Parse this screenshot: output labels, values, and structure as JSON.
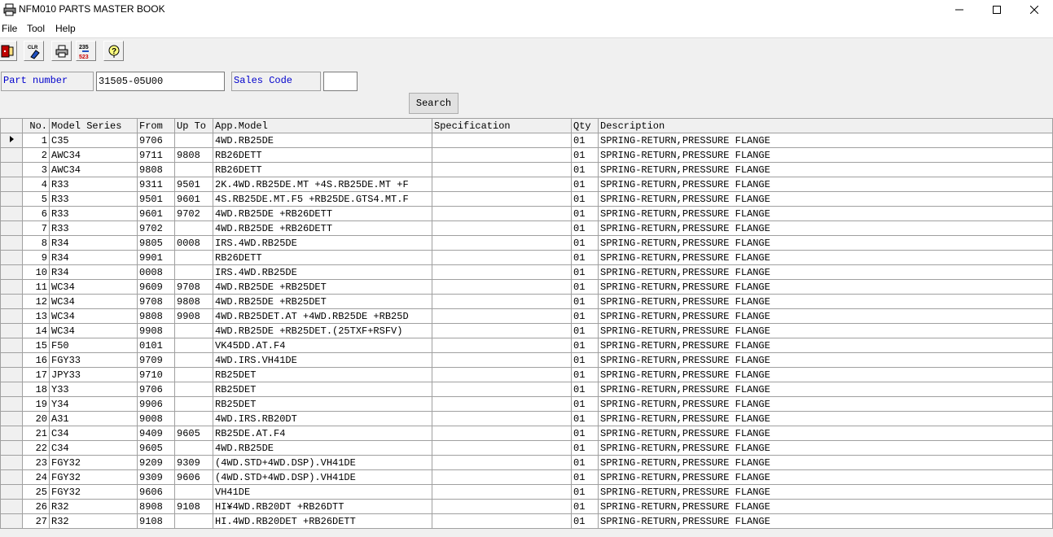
{
  "window": {
    "title": "NFM010 PARTS MASTER BOOK"
  },
  "menu": [
    {
      "label": "File"
    },
    {
      "label": "Tool"
    },
    {
      "label": "Help"
    }
  ],
  "toolbar": {
    "clr_label": "CLR",
    "calc_label_top": "235",
    "calc_label_bottom": "523"
  },
  "form": {
    "part_number_label": "Part number",
    "part_number_value": "31505-05U00",
    "sales_code_label": "Sales Code",
    "sales_code_value": "",
    "search_label": "Search"
  },
  "table": {
    "columns": [
      "No.",
      "Model Series",
      "From",
      "Up To",
      "App.Model",
      "Specification",
      "Qty",
      "Description"
    ],
    "rows": [
      [
        "1",
        "C35",
        "9706",
        "",
        "4WD.RB25DE",
        "",
        "01",
        "SPRING-RETURN,PRESSURE FLANGE"
      ],
      [
        "2",
        "AWC34",
        "9711",
        "9808",
        "RB26DETT",
        "",
        "01",
        "SPRING-RETURN,PRESSURE FLANGE"
      ],
      [
        "3",
        "AWC34",
        "9808",
        "",
        "RB26DETT",
        "",
        "01",
        "SPRING-RETURN,PRESSURE FLANGE"
      ],
      [
        "4",
        "R33",
        "9311",
        "9501",
        "2K.4WD.RB25DE.MT +4S.RB25DE.MT +F",
        "",
        "01",
        "SPRING-RETURN,PRESSURE FLANGE"
      ],
      [
        "5",
        "R33",
        "9501",
        "9601",
        "4S.RB25DE.MT.F5 +RB25DE.GTS4.MT.F",
        "",
        "01",
        "SPRING-RETURN,PRESSURE FLANGE"
      ],
      [
        "6",
        "R33",
        "9601",
        "9702",
        "4WD.RB25DE +RB26DETT",
        "",
        "01",
        "SPRING-RETURN,PRESSURE FLANGE"
      ],
      [
        "7",
        "R33",
        "9702",
        "",
        "4WD.RB25DE +RB26DETT",
        "",
        "01",
        "SPRING-RETURN,PRESSURE FLANGE"
      ],
      [
        "8",
        "R34",
        "9805",
        "0008",
        "IRS.4WD.RB25DE",
        "",
        "01",
        "SPRING-RETURN,PRESSURE FLANGE"
      ],
      [
        "9",
        "R34",
        "9901",
        "",
        "RB26DETT",
        "",
        "01",
        "SPRING-RETURN,PRESSURE FLANGE"
      ],
      [
        "10",
        "R34",
        "0008",
        "",
        "IRS.4WD.RB25DE",
        "",
        "01",
        "SPRING-RETURN,PRESSURE FLANGE"
      ],
      [
        "11",
        "WC34",
        "9609",
        "9708",
        "4WD.RB25DE +RB25DET",
        "",
        "01",
        "SPRING-RETURN,PRESSURE FLANGE"
      ],
      [
        "12",
        "WC34",
        "9708",
        "9808",
        "4WD.RB25DE +RB25DET",
        "",
        "01",
        "SPRING-RETURN,PRESSURE FLANGE"
      ],
      [
        "13",
        "WC34",
        "9808",
        "9908",
        "4WD.RB25DET.AT +4WD.RB25DE +RB25D",
        "",
        "01",
        "SPRING-RETURN,PRESSURE FLANGE"
      ],
      [
        "14",
        "WC34",
        "9908",
        "",
        "4WD.RB25DE +RB25DET.(25TXF+RSFV)",
        "",
        "01",
        "SPRING-RETURN,PRESSURE FLANGE"
      ],
      [
        "15",
        "F50",
        "0101",
        "",
        "VK45DD.AT.F4",
        "",
        "01",
        "SPRING-RETURN,PRESSURE FLANGE"
      ],
      [
        "16",
        "FGY33",
        "9709",
        "",
        "4WD.IRS.VH41DE",
        "",
        "01",
        "SPRING-RETURN,PRESSURE FLANGE"
      ],
      [
        "17",
        "JPY33",
        "9710",
        "",
        "RB25DET",
        "",
        "01",
        "SPRING-RETURN,PRESSURE FLANGE"
      ],
      [
        "18",
        "Y33",
        "9706",
        "",
        "RB25DET",
        "",
        "01",
        "SPRING-RETURN,PRESSURE FLANGE"
      ],
      [
        "19",
        "Y34",
        "9906",
        "",
        "RB25DET",
        "",
        "01",
        "SPRING-RETURN,PRESSURE FLANGE"
      ],
      [
        "20",
        "A31",
        "9008",
        "",
        "4WD.IRS.RB20DT",
        "",
        "01",
        "SPRING-RETURN,PRESSURE FLANGE"
      ],
      [
        "21",
        "C34",
        "9409",
        "9605",
        "RB25DE.AT.F4",
        "",
        "01",
        "SPRING-RETURN,PRESSURE FLANGE"
      ],
      [
        "22",
        "C34",
        "9605",
        "",
        "4WD.RB25DE",
        "",
        "01",
        "SPRING-RETURN,PRESSURE FLANGE"
      ],
      [
        "23",
        "FGY32",
        "9209",
        "9309",
        "(4WD.STD+4WD.DSP).VH41DE",
        "",
        "01",
        "SPRING-RETURN,PRESSURE FLANGE"
      ],
      [
        "24",
        "FGY32",
        "9309",
        "9606",
        "(4WD.STD+4WD.DSP).VH41DE",
        "",
        "01",
        "SPRING-RETURN,PRESSURE FLANGE"
      ],
      [
        "25",
        "FGY32",
        "9606",
        "",
        "VH41DE",
        "",
        "01",
        "SPRING-RETURN,PRESSURE FLANGE"
      ],
      [
        "26",
        "R32",
        "8908",
        "9108",
        "HI¥4WD.RB20DT +RB26DTT",
        "",
        "01",
        "SPRING-RETURN,PRESSURE FLANGE"
      ],
      [
        "27",
        "R32",
        "9108",
        "",
        "HI.4WD.RB20DET +RB26DETT",
        "",
        "01",
        "SPRING-RETURN,PRESSURE FLANGE"
      ]
    ]
  }
}
